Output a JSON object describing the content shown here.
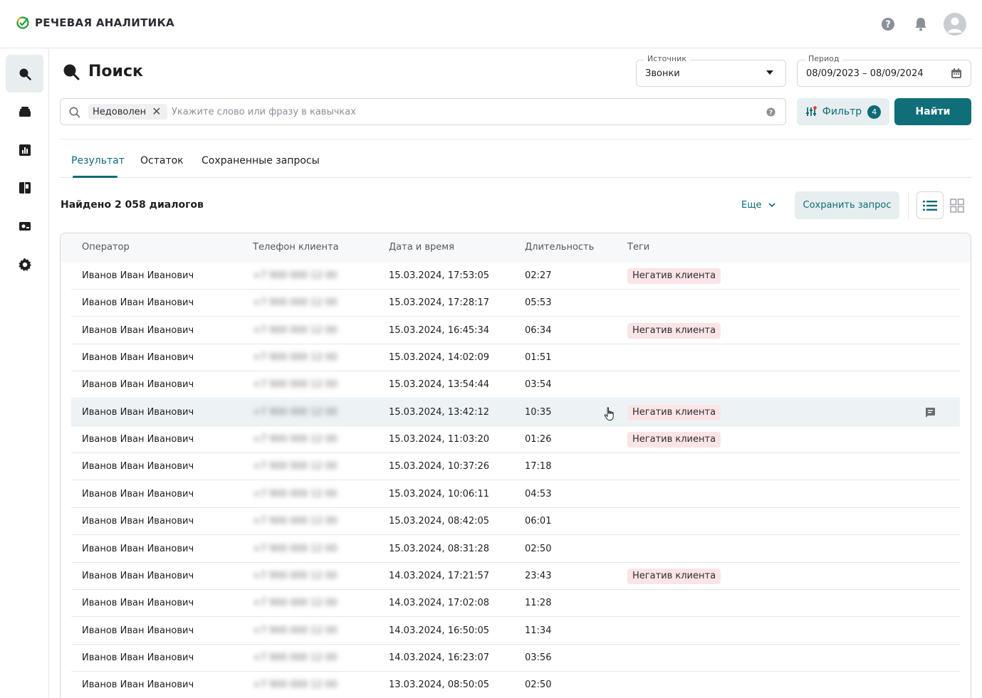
{
  "app": {
    "title": "РЕЧЕВАЯ АНАЛИТИКА"
  },
  "topbar": {
    "icons": [
      "help-icon",
      "bell-icon",
      "avatar"
    ]
  },
  "sidenav": {
    "items": [
      "search-icon",
      "folder-icon",
      "chart-icon",
      "book-icon",
      "card-icon",
      "gear-icon"
    ],
    "active": 0
  },
  "page": {
    "title": "Поиск"
  },
  "source": {
    "label": "Источник",
    "value": "Звонки"
  },
  "period": {
    "label": "Период",
    "value": "08/09/2023 – 08/09/2024"
  },
  "search": {
    "chip": "Недоволен",
    "placeholder": "Укажите слово или фразу в кавычках"
  },
  "filter": {
    "label": "Фильтр",
    "count": "4"
  },
  "find_button": "Найти",
  "tabs": [
    {
      "label": "Результат",
      "active": true
    },
    {
      "label": "Остаток",
      "active": false
    },
    {
      "label": "Сохраненные запросы",
      "active": false
    }
  ],
  "results": {
    "found": "Найдено 2 058 диалогов",
    "more": "Еще",
    "save": "Сохранить запрос"
  },
  "colors": {
    "accent": "#106e79",
    "tag_bg": "#fbe4e6",
    "highlight": "#edf3f5"
  },
  "table": {
    "headers": [
      "Оператор",
      "Телефон клиента",
      "Дата и время",
      "Длительность",
      "Теги"
    ],
    "rows": [
      {
        "operator": "Иванов Иван Иванович",
        "phone": "+7 900 000 12 00",
        "datetime": "15.03.2024, 17:53:05",
        "duration": "02:27",
        "tag": "Негатив клиента"
      },
      {
        "operator": "Иванов Иван Иванович",
        "phone": "+7 900 000 12 00",
        "datetime": "15.03.2024, 17:28:17",
        "duration": "05:53",
        "tag": ""
      },
      {
        "operator": "Иванов Иван Иванович",
        "phone": "+7 900 000 12 00",
        "datetime": "15.03.2024, 16:45:34",
        "duration": "06:34",
        "tag": "Негатив клиента"
      },
      {
        "operator": "Иванов Иван Иванович",
        "phone": "+7 900 000 12 00",
        "datetime": "15.03.2024, 14:02:09",
        "duration": "01:51",
        "tag": ""
      },
      {
        "operator": "Иванов Иван Иванович",
        "phone": "+7 900 000 12 00",
        "datetime": "15.03.2024, 13:54:44",
        "duration": "03:54",
        "tag": ""
      },
      {
        "operator": "Иванов Иван Иванович",
        "phone": "+7 900 000 12 00",
        "datetime": "15.03.2024, 13:42:12",
        "duration": "10:35",
        "tag": "Негатив клиента",
        "highlighted": true
      },
      {
        "operator": "Иванов Иван Иванович",
        "phone": "+7 900 000 12 00",
        "datetime": "15.03.2024, 11:03:20",
        "duration": "01:26",
        "tag": "Негатив клиента"
      },
      {
        "operator": "Иванов Иван Иванович",
        "phone": "+7 900 000 12 00",
        "datetime": "15.03.2024, 10:37:26",
        "duration": "17:18",
        "tag": ""
      },
      {
        "operator": "Иванов Иван Иванович",
        "phone": "+7 900 000 12 00",
        "datetime": "15.03.2024, 10:06:11",
        "duration": "04:53",
        "tag": ""
      },
      {
        "operator": "Иванов Иван Иванович",
        "phone": "+7 900 000 12 00",
        "datetime": "15.03.2024, 08:42:05",
        "duration": "06:01",
        "tag": ""
      },
      {
        "operator": "Иванов Иван Иванович",
        "phone": "+7 900 000 12 00",
        "datetime": "15.03.2024, 08:31:28",
        "duration": "02:50",
        "tag": ""
      },
      {
        "operator": "Иванов Иван Иванович",
        "phone": "+7 900 000 12 00",
        "datetime": "14.03.2024, 17:21:57",
        "duration": "23:43",
        "tag": "Негатив клиента"
      },
      {
        "operator": "Иванов Иван Иванович",
        "phone": "+7 900 000 12 00",
        "datetime": "14.03.2024, 17:02:08",
        "duration": "11:28",
        "tag": ""
      },
      {
        "operator": "Иванов Иван Иванович",
        "phone": "+7 900 000 12 00",
        "datetime": "14.03.2024, 16:50:05",
        "duration": "11:34",
        "tag": ""
      },
      {
        "operator": "Иванов Иван Иванович",
        "phone": "+7 900 000 12 00",
        "datetime": "14.03.2024, 16:23:07",
        "duration": "03:56",
        "tag": ""
      },
      {
        "operator": "Иванов Иван Иванович",
        "phone": "+7 900 000 12 00",
        "datetime": "13.03.2024, 08:50:05",
        "duration": "02:50",
        "tag": ""
      }
    ]
  }
}
